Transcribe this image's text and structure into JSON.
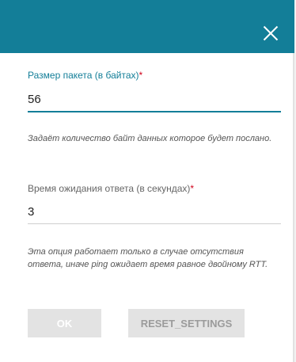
{
  "header": {
    "close_icon": "close-icon",
    "background_color": "#137e98"
  },
  "packet_size": {
    "label": "Размер пакета (в байтах)",
    "required_mark": "*",
    "value": "56",
    "hint": "Задаёт количество байт данных которое будет послано."
  },
  "timeout": {
    "label": "Время ожидания ответа (в секундах)",
    "required_mark": "*",
    "value": "3",
    "hint": "Эта опция работает только в случае отсутствия ответа, иначе ping ожидает время равное двойному RTT."
  },
  "buttons": {
    "ok_label": "OK",
    "reset_label": "RESET_SETTINGS"
  },
  "colors": {
    "accent": "#137e98",
    "required": "#d0021b",
    "button_disabled_bg": "#e3e3e3"
  }
}
